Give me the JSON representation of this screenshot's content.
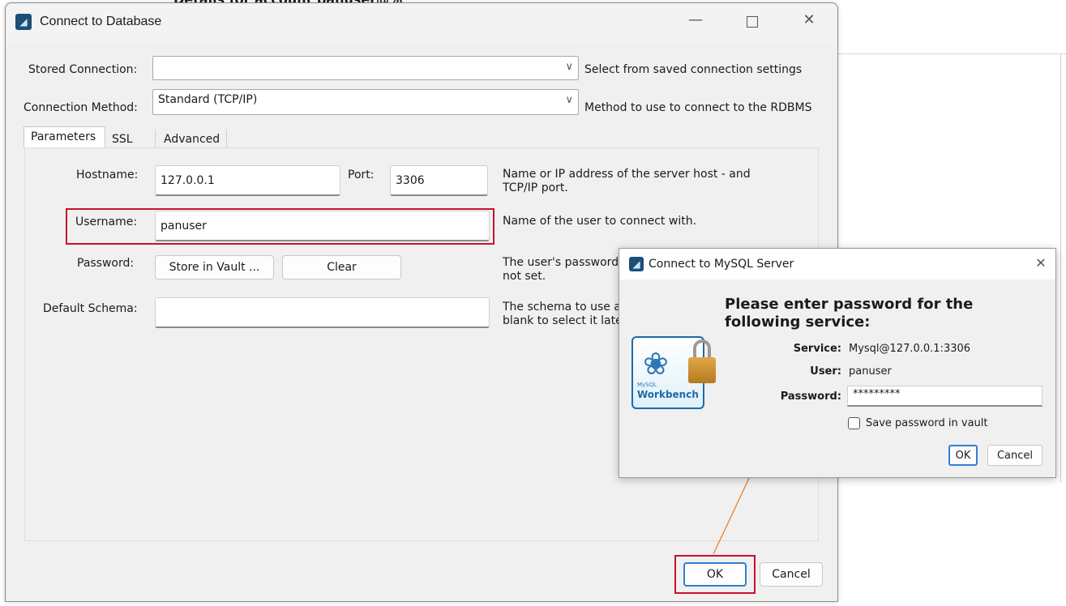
{
  "background": {
    "heading": "Details for account panuser@%"
  },
  "dialog": {
    "title": "Connect to Database",
    "stored_connection_label": "Stored Connection:",
    "stored_connection_value": "",
    "stored_connection_hint": "Select from saved connection settings",
    "connection_method_label": "Connection Method:",
    "connection_method_value": "Standard (TCP/IP)",
    "connection_method_hint": "Method to use to connect to the RDBMS",
    "tabs": [
      {
        "label": "Parameters",
        "active": true
      },
      {
        "label": "SSL",
        "active": false
      },
      {
        "label": "Advanced",
        "active": false
      }
    ],
    "hostname_label": "Hostname:",
    "hostname_value": "127.0.0.1",
    "port_label": "Port:",
    "port_value": "3306",
    "hostname_hint_1": "Name or IP address of the server host - and",
    "hostname_hint_2": "TCP/IP port.",
    "username_label": "Username:",
    "username_value": "panuser",
    "username_hint": "Name of the user to connect with.",
    "password_label": "Password:",
    "store_vault_button": "Store in Vault ...",
    "clear_button": "Clear",
    "password_hint_1": "The user's password",
    "password_hint_2": "not set.",
    "default_schema_label": "Default Schema:",
    "default_schema_value": "",
    "schema_hint_1": "The schema to use a",
    "schema_hint_2": "blank to select it late",
    "ok_button": "OK",
    "cancel_button": "Cancel"
  },
  "popup": {
    "title": "Connect to MySQL Server",
    "heading_1": "Please enter password for the",
    "heading_2": "following service:",
    "service_label": "Service:",
    "service_value": "Mysql@127.0.0.1:3306",
    "user_label": "User:",
    "user_value": "panuser",
    "password_label": "Password:",
    "password_value": "*********",
    "save_in_vault_label": "Save password in vault",
    "save_in_vault_checked": false,
    "ok_button": "OK",
    "cancel_button": "Cancel",
    "logo_text_1": "MySQL",
    "logo_text_2": "Workbench"
  },
  "colors": {
    "highlight": "#c8102e",
    "arrow": "#e8822a",
    "default_button_border": "#2f7fd1"
  }
}
